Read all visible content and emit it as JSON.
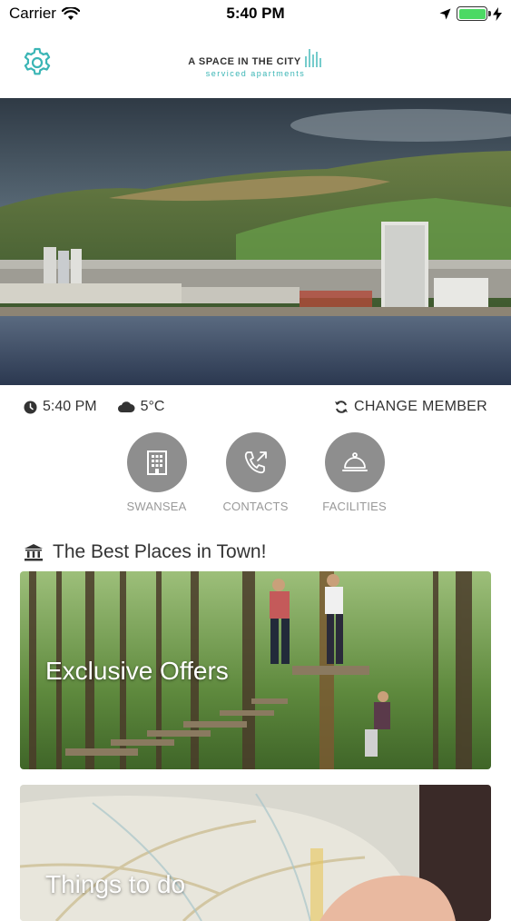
{
  "status_bar": {
    "carrier": "Carrier",
    "time": "5:40 PM",
    "battery_level": 1.0
  },
  "header": {
    "logo_main": "A SPACE IN THE CITY",
    "logo_sub": "serviced apartments",
    "accent_color": "#3ab5b5"
  },
  "info": {
    "time": "5:40 PM",
    "temperature": "5°C",
    "change_member_label": "CHANGE MEMBER"
  },
  "quick_actions": [
    {
      "label": "SWANSEA",
      "icon": "building-icon"
    },
    {
      "label": "CONTACTS",
      "icon": "phone-icon"
    },
    {
      "label": "FACILITIES",
      "icon": "service-bell-icon"
    }
  ],
  "section": {
    "title": "The Best Places in Town!"
  },
  "cards": [
    {
      "title": "Exclusive Offers"
    },
    {
      "title": "Things to do"
    }
  ]
}
